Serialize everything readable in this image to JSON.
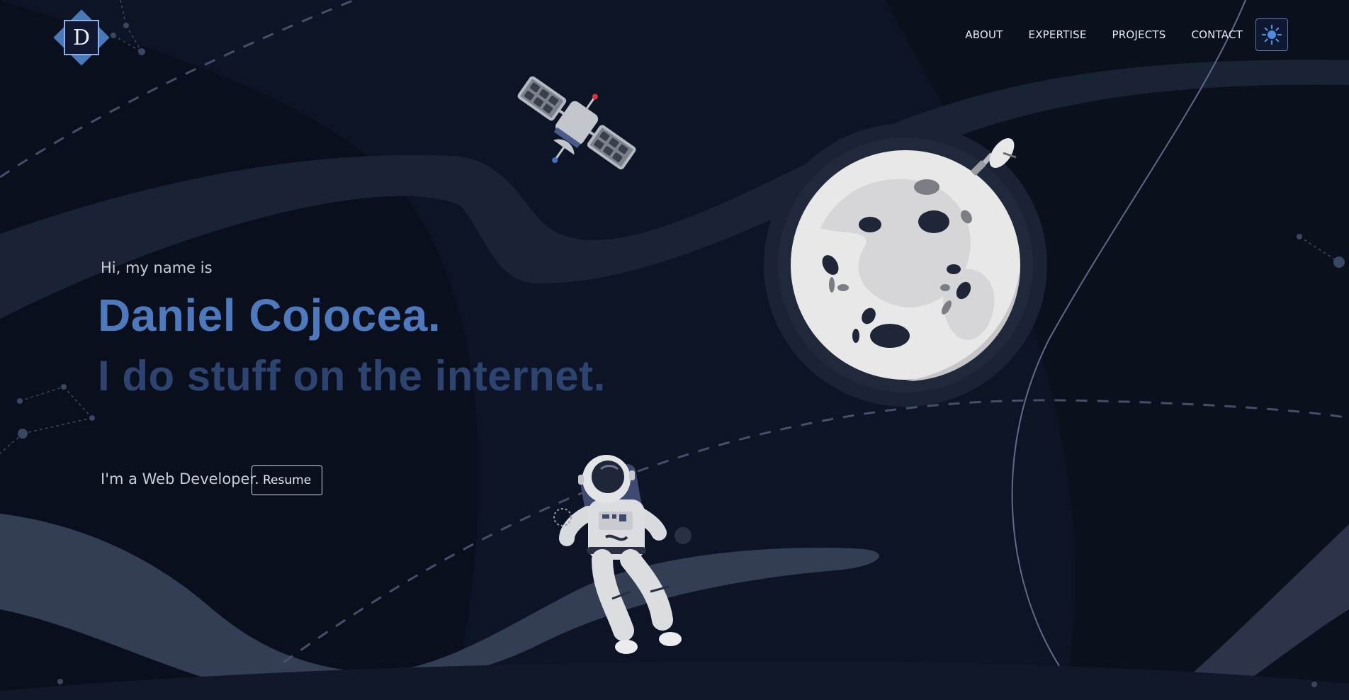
{
  "logo": {
    "letter": "D"
  },
  "nav": {
    "items": [
      {
        "label": "ABOUT"
      },
      {
        "label": "EXPERTISE"
      },
      {
        "label": "PROJECTS"
      },
      {
        "label": "CONTACT"
      }
    ],
    "theme_toggle_icon": "sun-icon"
  },
  "hero": {
    "greeting": "Hi, my name is",
    "name": "Daniel Cojocea.",
    "tagline": "I do stuff on the internet.",
    "role": "I'm a Web Developer.",
    "resume_label": "Resume"
  },
  "colors": {
    "background": "#0d1426",
    "accent": "#4f79bd",
    "tagline": "#2e4470"
  }
}
